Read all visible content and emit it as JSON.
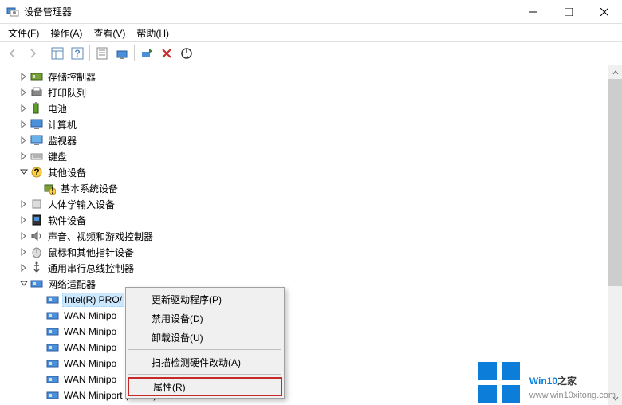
{
  "window": {
    "title": "设备管理器"
  },
  "menu": {
    "file": "文件(F)",
    "action": "操作(A)",
    "view": "查看(V)",
    "help": "帮助(H)"
  },
  "tree": {
    "storage_controllers": "存储控制器",
    "print_queues": "打印队列",
    "batteries": "电池",
    "computer": "计算机",
    "monitors": "监视器",
    "keyboards": "键盘",
    "other_devices": "其他设备",
    "base_system_device": "基本系统设备",
    "hid": "人体学输入设备",
    "software_devices": "软件设备",
    "sound": "声音、视频和游戏控制器",
    "mice": "鼠标和其他指针设备",
    "usb": "通用串行总线控制器",
    "network_adapters": "网络适配器",
    "intel_pro": "Intel(R) PRO/",
    "wan_minipo": "WAN Minipo",
    "wan_miniport_last": "WAN Miniport (PPTP)"
  },
  "context_menu": {
    "update_driver": "更新驱动程序(P)",
    "disable": "禁用设备(D)",
    "uninstall": "卸载设备(U)",
    "scan_hw": "扫描检测硬件改动(A)",
    "properties": "属性(R)"
  },
  "watermark": {
    "brand_a": "Win10",
    "brand_b": "之家",
    "url": "www.win10xitong.com"
  }
}
